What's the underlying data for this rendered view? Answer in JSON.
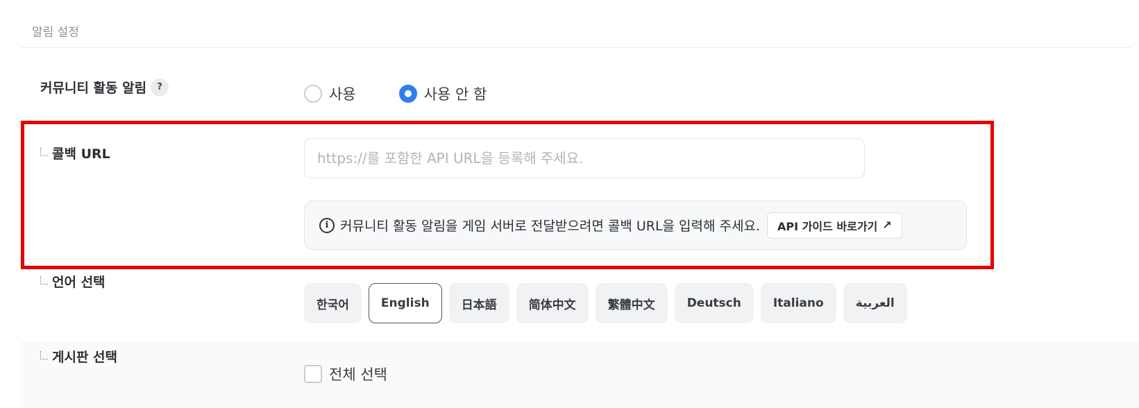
{
  "section": {
    "title": "알림 설정"
  },
  "community_alert": {
    "label": "커뮤니티 활동 알림",
    "help_badge": "?",
    "options": [
      {
        "label": "사용",
        "selected": false
      },
      {
        "label": "사용 안 함",
        "selected": true
      }
    ]
  },
  "callback_url": {
    "label": "콜백 URL",
    "value": "",
    "placeholder": "https://를 포함한 API URL을 등록해 주세요.",
    "info_text": "커뮤니티 활동 알림을 게임 서버로 전달받으려면 콜백 URL을 입력해 주세요.",
    "guide_button": "API 가이드 바로가기",
    "guide_arrow": "↗"
  },
  "language": {
    "label": "언어 선택",
    "options": [
      "한국어",
      "English",
      "日本語",
      "简体中文",
      "繁體中文",
      "Deutsch",
      "Italiano",
      "العربية"
    ],
    "selected": "English"
  },
  "board": {
    "label": "게시판 선택",
    "select_all": "전체 선택",
    "checked": false
  },
  "colors": {
    "accent": "#2f80ed",
    "highlight": "#e60000"
  },
  "icons": {
    "info": "info-icon",
    "external": "arrow-up-right-icon"
  }
}
